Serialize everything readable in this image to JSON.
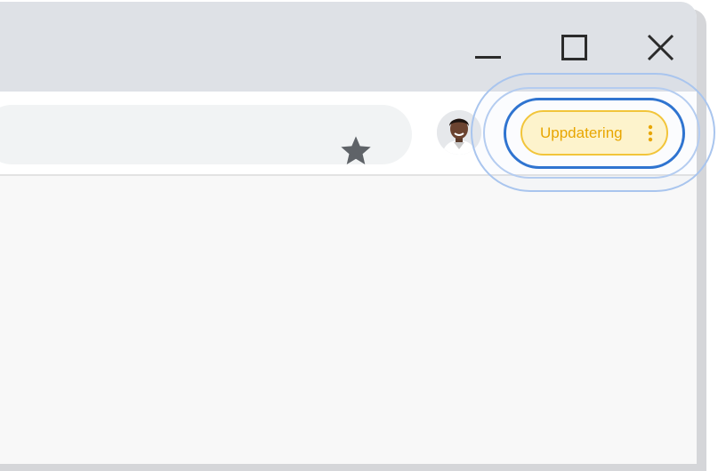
{
  "window": {
    "controls": [
      {
        "name": "minimize",
        "icon": "minimize-icon"
      },
      {
        "name": "maximize",
        "icon": "maximize-icon"
      },
      {
        "name": "close",
        "icon": "close-icon"
      }
    ]
  },
  "toolbar": {
    "bookmark_icon": "star-icon",
    "profile_icon": "avatar",
    "update_button": {
      "label": "Uppdatering",
      "menu_icon": "more-vert-icon"
    }
  },
  "colors": {
    "titlebar": "#dee1e6",
    "toolbar": "#ffffff",
    "omnibox": "#f1f3f4",
    "content": "#f8f8f8",
    "update_fill": "#fdf3cc",
    "update_border": "#f2c53a",
    "update_text": "#e8a600",
    "focus_ring": "#2f74d0"
  }
}
